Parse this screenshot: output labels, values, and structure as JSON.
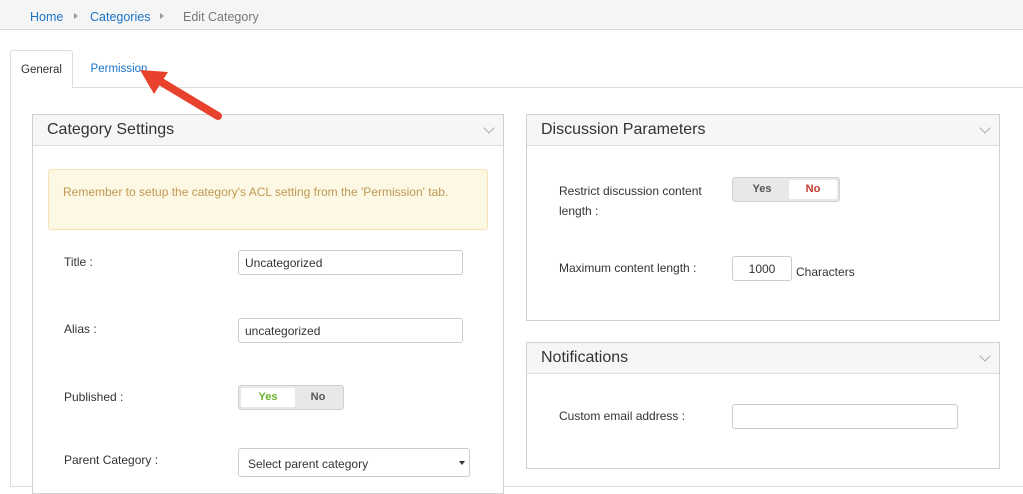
{
  "breadcrumb": {
    "home": "Home",
    "categories": "Categories",
    "current": "Edit Category"
  },
  "tabs": [
    {
      "label": "General"
    },
    {
      "label": "Permission"
    }
  ],
  "category_settings": {
    "title": "Category Settings",
    "alert": "Remember to setup the category's ACL setting from the 'Permission' tab.",
    "title_label": "Title :",
    "title_value": "Uncategorized",
    "alias_label": "Alias :",
    "alias_value": "uncategorized",
    "published_label": "Published :",
    "published_yes": "Yes",
    "published_no": "No",
    "parent_label": "Parent Category :",
    "parent_value": "Select parent category"
  },
  "discussion": {
    "title": "Discussion Parameters",
    "restrict_label": "Restrict discussion content length :",
    "restrict_yes": "Yes",
    "restrict_no": "No",
    "max_label": "Maximum content length :",
    "max_value": "1000",
    "max_unit": "Characters"
  },
  "notifications": {
    "title": "Notifications",
    "email_label": "Custom email address :",
    "email_value": ""
  },
  "colors": {
    "link": "#1a73c8",
    "yes_active": "#6bb32e",
    "no_active": "#c0392b",
    "arrow": "#e8412c"
  }
}
